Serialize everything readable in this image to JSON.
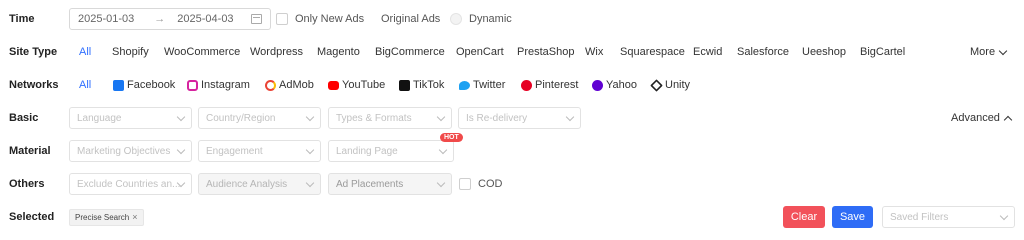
{
  "rows": {
    "time": "Time",
    "site_type": "Site Type",
    "networks": "Networks",
    "basic": "Basic",
    "material": "Material",
    "others": "Others",
    "selected": "Selected"
  },
  "time": {
    "start": "2025-01-03",
    "arrow": "→",
    "end": "2025-04-03",
    "only_new_ads": "Only New Ads",
    "original_ads": "Original Ads",
    "dynamic": "Dynamic"
  },
  "site_types": [
    "All",
    "Shopify",
    "WooCommerce",
    "Wordpress",
    "Magento",
    "BigCommerce",
    "OpenCart",
    "PrestaShop",
    "Wix",
    "Squarespace",
    "Ecwid",
    "Salesforce",
    "Ueeshop",
    "BigCartel"
  ],
  "site_more": "More",
  "networks": [
    "All",
    "Facebook",
    "Instagram",
    "AdMob",
    "YouTube",
    "TikTok",
    "Twitter",
    "Pinterest",
    "Yahoo",
    "Unity"
  ],
  "basic": {
    "language": "Language",
    "country": "Country/Region",
    "types": "Types & Formats",
    "redelivery": "Is Re-delivery",
    "advanced": "Advanced"
  },
  "material": {
    "objectives": "Marketing Objectives",
    "engagement": "Engagement",
    "landing": "Landing Page",
    "hot": "HOT"
  },
  "others": {
    "exclude": "Exclude Countries an...",
    "audience": "Audience Analysis",
    "placements": "Ad Placements",
    "cod": "COD"
  },
  "selected": {
    "tag": "Precise Search",
    "tag_close": "×",
    "clear": "Clear",
    "save": "Save",
    "saved_filters": "Saved Filters"
  },
  "colors": {
    "accent": "#2f6fff",
    "clear": "#f2515a",
    "save": "#2e6cf6",
    "hot": "#f04a4a"
  }
}
